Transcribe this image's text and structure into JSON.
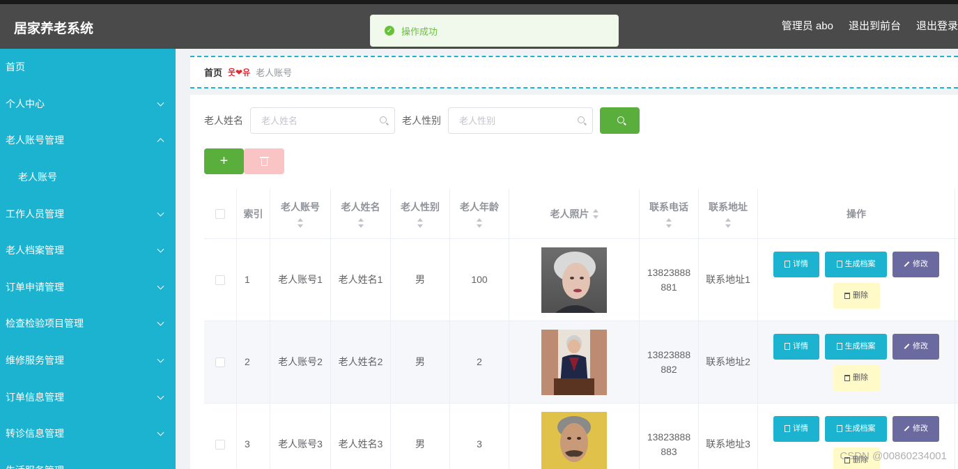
{
  "header": {
    "app_title": "居家养老系统",
    "user_label": "管理员 abo",
    "front_link": "退出到前台",
    "logout_link": "退出登录"
  },
  "toast": {
    "message": "操作成功",
    "icon": "check-circle-icon",
    "color": "#67c23a"
  },
  "sidebar": {
    "bg_color": "#1bb3d0",
    "items": [
      {
        "label": "首页"
      },
      {
        "label": "个人中心",
        "chevron": "down"
      },
      {
        "label": "老人账号管理",
        "chevron": "up"
      },
      {
        "label": "老人账号",
        "sub": true
      },
      {
        "label": "工作人员管理",
        "chevron": "down"
      },
      {
        "label": "老人档案管理",
        "chevron": "down"
      },
      {
        "label": "订单申请管理",
        "chevron": "down"
      },
      {
        "label": "检查检验项目管理",
        "chevron": "down"
      },
      {
        "label": "维修服务管理",
        "chevron": "down"
      },
      {
        "label": "订单信息管理",
        "chevron": "down"
      },
      {
        "label": "转诊信息管理",
        "chevron": "down"
      },
      {
        "label": "生活服务管理",
        "chevron": "down"
      }
    ]
  },
  "breadcrumb": {
    "home": "首页",
    "separator": "웃❤유",
    "current": "老人账号"
  },
  "search": {
    "name_label": "老人姓名",
    "name_placeholder": "老人姓名",
    "gender_label": "老人性别",
    "gender_placeholder": "老人性别"
  },
  "table": {
    "headers": {
      "index": "索引",
      "account": "老人账号",
      "name": "老人姓名",
      "gender": "老人性别",
      "age": "老人年龄",
      "photo": "老人照片",
      "phone": "联系电话",
      "address": "联系地址",
      "ops": "操作"
    },
    "actions": {
      "detail": "详情",
      "generate": "生成档案",
      "edit": "修改",
      "delete": "删除"
    },
    "rows": [
      {
        "index": "1",
        "account": "老人账号1",
        "name": "老人姓名1",
        "gender": "男",
        "age": "100",
        "phone_line1": "13823888",
        "phone_line2": "881",
        "address": "联系地址1"
      },
      {
        "index": "2",
        "account": "老人账号2",
        "name": "老人姓名2",
        "gender": "男",
        "age": "2",
        "phone_line1": "13823888",
        "phone_line2": "882",
        "address": "联系地址2"
      },
      {
        "index": "3",
        "account": "老人账号3",
        "name": "老人姓名3",
        "gender": "男",
        "age": "3",
        "phone_line1": "13823888",
        "phone_line2": "883",
        "address": "联系地址3"
      }
    ]
  },
  "watermark": "CSDN @00860234001"
}
